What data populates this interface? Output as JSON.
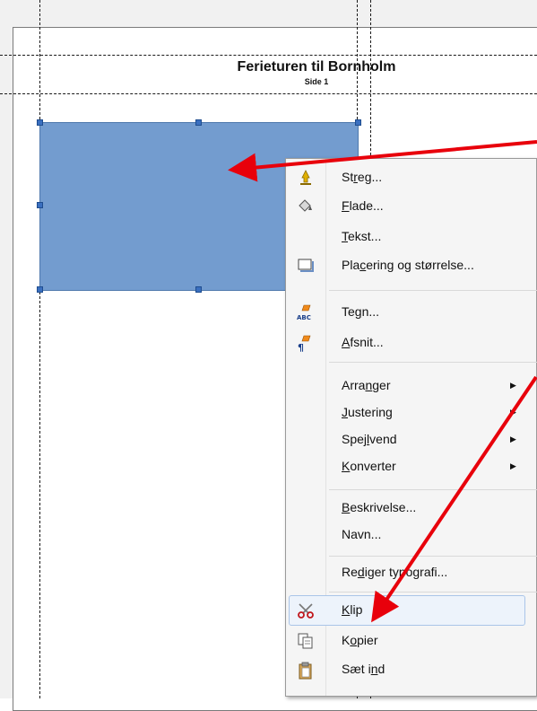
{
  "document": {
    "header_title": "Ferieturen til Bornholm",
    "header_subtitle": "Side 1"
  },
  "colors": {
    "shape_fill": "#739ccf",
    "selection_handle": "#3a6fbf",
    "annotation_arrow": "#e8000b",
    "menu_highlight": "#edf3fb"
  },
  "context_menu": {
    "items": [
      {
        "pre": "St",
        "u": "r",
        "post": "eg...",
        "icon": "line-icon",
        "submenu": false
      },
      {
        "pre": "",
        "u": "F",
        "post": "lade...",
        "icon": "area-fill-icon",
        "submenu": false
      },
      {
        "pre": "",
        "u": "T",
        "post": "ekst...",
        "icon": "",
        "submenu": false
      },
      {
        "pre": "Pla",
        "u": "c",
        "post": "ering og størrelse...",
        "icon": "position-size-icon",
        "submenu": false
      },
      {
        "pre": "Te",
        "u": "g",
        "post": "n...",
        "icon": "character-icon",
        "submenu": false
      },
      {
        "pre": "",
        "u": "A",
        "post": "fsnit...",
        "icon": "paragraph-icon",
        "submenu": false
      },
      {
        "pre": "Arra",
        "u": "n",
        "post": "ger",
        "icon": "",
        "submenu": true
      },
      {
        "pre": "",
        "u": "J",
        "post": "ustering",
        "icon": "",
        "submenu": true
      },
      {
        "pre": "Spej",
        "u": "l",
        "post": "vend",
        "icon": "",
        "submenu": true
      },
      {
        "pre": "",
        "u": "K",
        "post": "onverter",
        "icon": "",
        "submenu": true
      },
      {
        "pre": "",
        "u": "B",
        "post": "eskrivelse...",
        "icon": "",
        "submenu": false
      },
      {
        "pre": "Navn...",
        "u": "",
        "post": "",
        "icon": "",
        "submenu": false
      },
      {
        "pre": "Re",
        "u": "d",
        "post": "iger typografi...",
        "icon": "",
        "submenu": false
      },
      {
        "pre": "",
        "u": "K",
        "post": "lip",
        "icon": "scissors-icon",
        "submenu": false
      },
      {
        "pre": "K",
        "u": "o",
        "post": "pier",
        "icon": "copy-icon",
        "submenu": false
      },
      {
        "pre": "Sæt i",
        "u": "n",
        "post": "d",
        "icon": "paste-icon",
        "submenu": false
      }
    ],
    "highlighted_item": "Klip"
  }
}
